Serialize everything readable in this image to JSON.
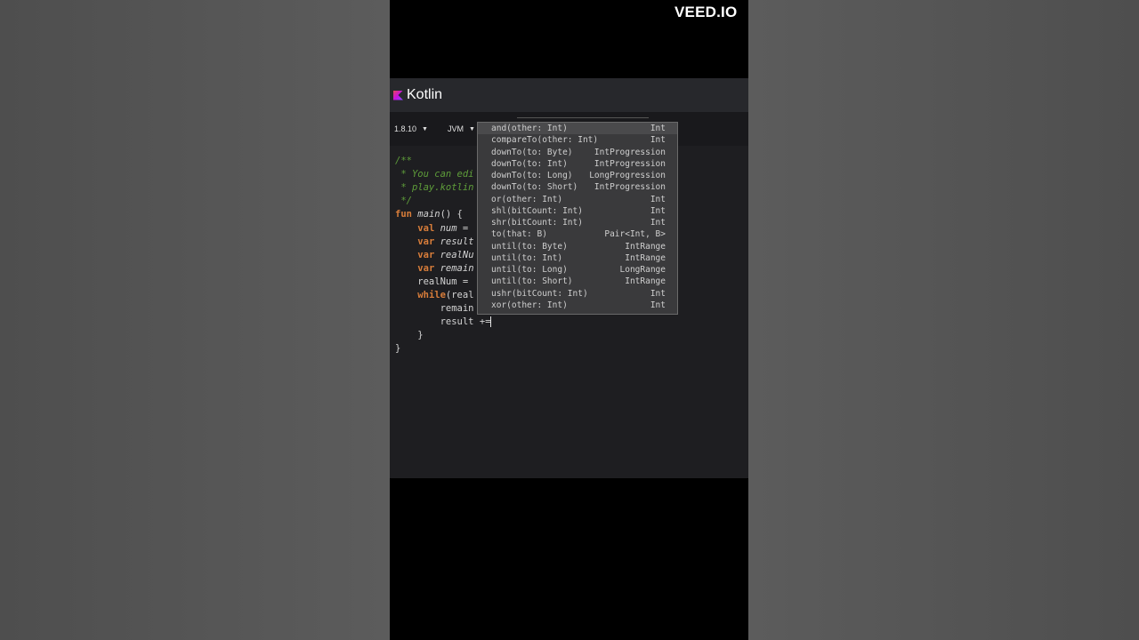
{
  "watermark": "VEED.IO",
  "header": {
    "logo_text": "Kotlin"
  },
  "toolbar": {
    "version": "1.8.10",
    "target": "JVM"
  },
  "code": [
    {
      "parts": [
        {
          "t": "/**",
          "c": "c-comment"
        }
      ]
    },
    {
      "parts": [
        {
          "t": " * You can edi",
          "c": "c-comment"
        }
      ]
    },
    {
      "parts": [
        {
          "t": " * play.kotlin",
          "c": "c-comment"
        }
      ]
    },
    {
      "parts": [
        {
          "t": " */",
          "c": "c-comment"
        }
      ]
    },
    {
      "parts": [
        {
          "t": "fun ",
          "c": "c-keyword"
        },
        {
          "t": "main",
          "c": "c-name"
        },
        {
          "t": "() {",
          "c": ""
        }
      ]
    },
    {
      "parts": [
        {
          "t": "    ",
          "c": ""
        },
        {
          "t": "val ",
          "c": "c-keyword"
        },
        {
          "t": "num",
          "c": "c-name"
        },
        {
          "t": " =",
          "c": ""
        }
      ]
    },
    {
      "parts": [
        {
          "t": "    ",
          "c": ""
        },
        {
          "t": "var ",
          "c": "c-keyword"
        },
        {
          "t": "result",
          "c": "c-name"
        }
      ]
    },
    {
      "parts": [
        {
          "t": "    ",
          "c": ""
        },
        {
          "t": "var ",
          "c": "c-keyword"
        },
        {
          "t": "realNu",
          "c": "c-name"
        }
      ]
    },
    {
      "parts": [
        {
          "t": "    ",
          "c": ""
        },
        {
          "t": "var ",
          "c": "c-keyword"
        },
        {
          "t": "remain",
          "c": "c-name"
        }
      ]
    },
    {
      "parts": [
        {
          "t": "    realNum =",
          "c": ""
        }
      ]
    },
    {
      "parts": [
        {
          "t": "    ",
          "c": ""
        },
        {
          "t": "while",
          "c": "c-keyword"
        },
        {
          "t": "(real",
          "c": ""
        }
      ]
    },
    {
      "parts": [
        {
          "t": "        remain",
          "c": ""
        }
      ]
    },
    {
      "parts": [
        {
          "t": "        result +=",
          "c": ""
        }
      ],
      "cursor": true
    },
    {
      "parts": [
        {
          "t": "    }",
          "c": ""
        }
      ]
    },
    {
      "parts": [
        {
          "t": "}",
          "c": ""
        }
      ]
    }
  ],
  "autocomplete": {
    "items": [
      {
        "name": "and(other: Int)",
        "type": "Int"
      },
      {
        "name": "compareTo(other: Int)",
        "type": "Int"
      },
      {
        "name": "downTo(to: Byte)",
        "type": "IntProgression"
      },
      {
        "name": "downTo(to: Int)",
        "type": "IntProgression"
      },
      {
        "name": "downTo(to: Long)",
        "type": "LongProgression"
      },
      {
        "name": "downTo(to: Short)",
        "type": "IntProgression"
      },
      {
        "name": "or(other: Int)",
        "type": "Int"
      },
      {
        "name": "shl(bitCount: Int)",
        "type": "Int"
      },
      {
        "name": "shr(bitCount: Int)",
        "type": "Int"
      },
      {
        "name": "to(that: B)",
        "type": "Pair<Int, B>"
      },
      {
        "name": "until(to: Byte)",
        "type": "IntRange"
      },
      {
        "name": "until(to: Int)",
        "type": "IntRange"
      },
      {
        "name": "until(to: Long)",
        "type": "LongRange"
      },
      {
        "name": "until(to: Short)",
        "type": "IntRange"
      },
      {
        "name": "ushr(bitCount: Int)",
        "type": "Int"
      },
      {
        "name": "xor(other: Int)",
        "type": "Int"
      }
    ]
  }
}
